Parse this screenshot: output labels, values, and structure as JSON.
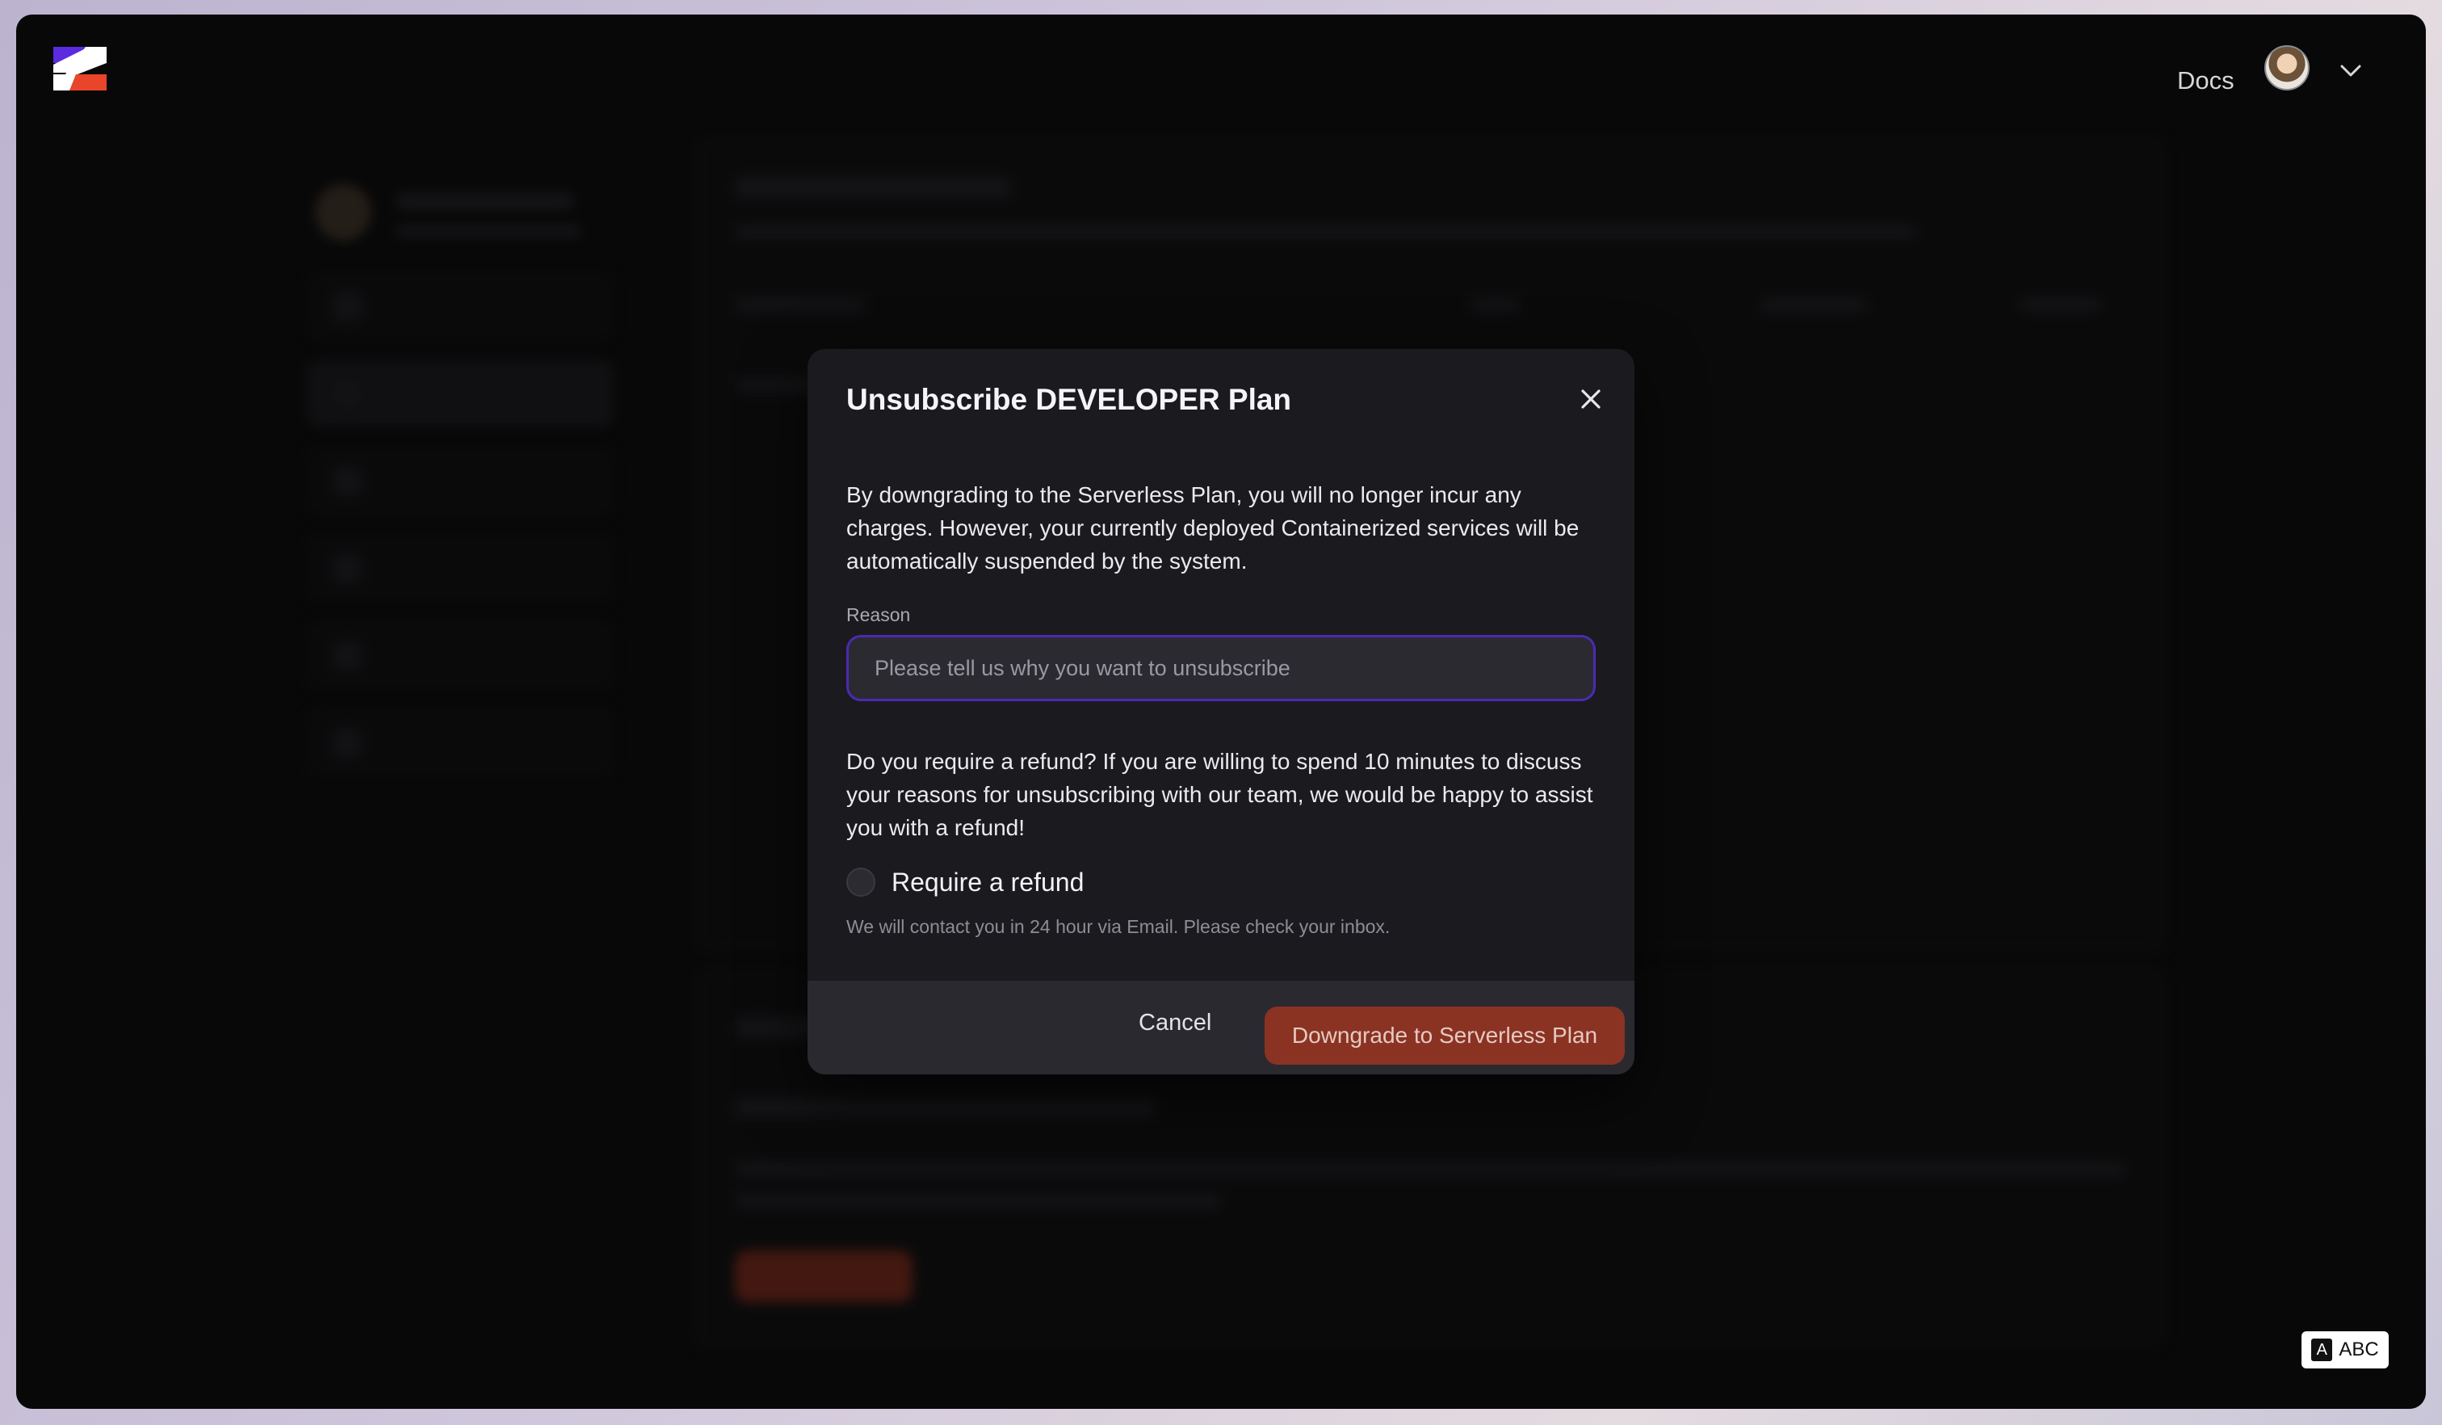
{
  "header": {
    "logo_icon": "brand-logo-icon",
    "docs_label": "Docs",
    "avatar_icon": "user-avatar-icon",
    "menu_icon": "chevron-down-icon"
  },
  "modal": {
    "title": "Unsubscribe DEVELOPER Plan",
    "close_icon": "close-icon",
    "description": "By downgrading to the Serverless Plan, you will no longer incur any charges. However, your currently deployed Containerized services will be automatically suspended by the system.",
    "reason_label": "Reason",
    "reason_value": "",
    "reason_placeholder": "Please tell us why you want to unsubscribe",
    "refund_text": "Do you require a refund? If you are willing to spend 10 minutes to discuss your reasons for unsubscribing with our team, we would be happy to assist you with a refund!",
    "refund_checkbox_label": "Require a refund",
    "refund_checked": false,
    "refund_hint": "We will contact you in 24 hour via Email. Please check your inbox.",
    "cancel_label": "Cancel",
    "confirm_label": "Downgrade to Serverless Plan"
  },
  "input_method": {
    "icon_letter": "A",
    "label": "ABC"
  },
  "colors": {
    "accent_purple": "#4b2ab4",
    "danger_button": "#8a3323",
    "logo_purple": "#5b2be0",
    "logo_red": "#e8452a"
  }
}
